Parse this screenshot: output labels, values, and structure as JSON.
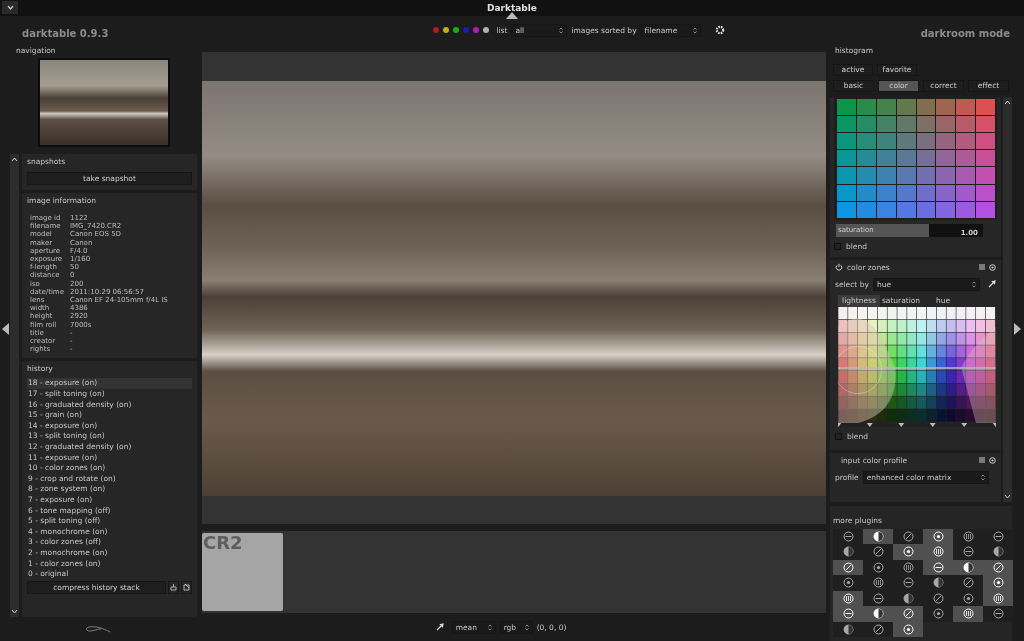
{
  "window": {
    "title": "Darktable"
  },
  "app": {
    "name": "darktable 0.9.3",
    "mode": "darkroom mode"
  },
  "filter_bar": {
    "color_labels": [
      {
        "color": "#b01c1c"
      },
      {
        "color": "#b8b01c"
      },
      {
        "color": "#1cae1c"
      },
      {
        "color": "#1c1cb0"
      },
      {
        "color": "#b01cb0"
      },
      {
        "color": "#b0b0b0"
      }
    ],
    "list_label": "list",
    "list_value": "all",
    "sort_label": "images sorted by",
    "sort_value": "filename"
  },
  "left": {
    "navigation": {
      "label": "navigation"
    },
    "snapshots": {
      "title": "snapshots",
      "button": "take snapshot"
    },
    "image_information": {
      "title": "image information",
      "fields": [
        {
          "label": "image id",
          "value": "1122"
        },
        {
          "label": "filename",
          "value": "IMG_7420.CR2"
        },
        {
          "label": "model",
          "value": "Canon EOS 5D"
        },
        {
          "label": "maker",
          "value": "Canon"
        },
        {
          "label": "aperture",
          "value": "F/4.0"
        },
        {
          "label": "exposure",
          "value": "1/160"
        },
        {
          "label": "f-length",
          "value": "50"
        },
        {
          "label": "distance",
          "value": "0"
        },
        {
          "label": "iso",
          "value": "200"
        },
        {
          "label": "date/time",
          "value": "2011:10:29 06:56:57"
        },
        {
          "label": "lens",
          "value": "Canon EF 24-105mm f/4L IS"
        },
        {
          "label": "width",
          "value": "4386"
        },
        {
          "label": "height",
          "value": "2920"
        },
        {
          "label": "film roll",
          "value": "7000s"
        },
        {
          "label": "title",
          "value": "-"
        },
        {
          "label": "creator",
          "value": "-"
        },
        {
          "label": "rights",
          "value": "-"
        }
      ]
    },
    "history": {
      "title": "history",
      "items": [
        {
          "label": "18 - exposure (on)",
          "selected": true
        },
        {
          "label": "17 - split toning (on)",
          "selected": false
        },
        {
          "label": "16 - graduated density (on)",
          "selected": false
        },
        {
          "label": "15 - grain (on)",
          "selected": false
        },
        {
          "label": "14 - exposure (on)",
          "selected": false
        },
        {
          "label": "13 - split toning (on)",
          "selected": false
        },
        {
          "label": "12 - graduated density (on)",
          "selected": false
        },
        {
          "label": "11 - exposure (on)",
          "selected": false
        },
        {
          "label": "10 - color zones (on)",
          "selected": false
        },
        {
          "label": "9 - crop and rotate (on)",
          "selected": false
        },
        {
          "label": "8 - zone system (on)",
          "selected": false
        },
        {
          "label": "7 - exposure (on)",
          "selected": false
        },
        {
          "label": "6 - tone mapping (off)",
          "selected": false
        },
        {
          "label": "5 - split toning (off)",
          "selected": false
        },
        {
          "label": "4 - monochrome (on)",
          "selected": false
        },
        {
          "label": "3 - color zones (off)",
          "selected": false
        },
        {
          "label": "2 - monochrome (on)",
          "selected": false
        },
        {
          "label": "1 - color zones (on)",
          "selected": false
        },
        {
          "label": "0 - original",
          "selected": false
        }
      ],
      "compress_button": "compress history stack"
    }
  },
  "filmstrip": {
    "thumbnail_label": "CR2"
  },
  "bottom_bar": {
    "mode": "mean",
    "colorspace": "rgb",
    "reading": "(0, 0, 0)"
  },
  "right": {
    "histogram": {
      "label": "histogram"
    },
    "preset_tabs": [
      {
        "label": "active",
        "selected": false
      },
      {
        "label": "favorite",
        "selected": false
      }
    ],
    "group_tabs": [
      {
        "label": "basic",
        "selected": false
      },
      {
        "label": "color",
        "selected": true
      },
      {
        "label": "correct",
        "selected": false
      },
      {
        "label": "effect",
        "selected": false
      }
    ],
    "color_correction": {
      "slider_label": "saturation",
      "slider_value": "1.00",
      "level": 0.63,
      "blend_label": "blend",
      "blend_checked": false
    },
    "color_zones": {
      "title": "color zones",
      "select_by_label": "select by",
      "select_by_value": "hue",
      "tabs": [
        {
          "label": "lightness",
          "selected": true
        },
        {
          "label": "saturation",
          "selected": false
        },
        {
          "label": "hue",
          "selected": false
        }
      ],
      "blend_label": "blend",
      "blend_checked": false
    },
    "input_color_profile": {
      "title": "input color profile",
      "profile_label": "profile",
      "profile_value": "enhanced color matrix"
    },
    "more_plugins": {
      "title": "more plugins",
      "plugins": [
        {
          "enabled": false
        },
        {
          "enabled": true
        },
        {
          "enabled": false
        },
        {
          "enabled": true
        },
        {
          "enabled": false
        },
        {
          "enabled": false
        },
        {
          "enabled": false
        },
        {
          "enabled": false
        },
        {
          "enabled": true
        },
        {
          "enabled": true
        },
        {
          "enabled": false
        },
        {
          "enabled": false
        },
        {
          "enabled": true
        },
        {
          "enabled": false
        },
        {
          "enabled": false
        },
        {
          "enabled": true
        },
        {
          "enabled": true
        },
        {
          "enabled": true
        },
        {
          "enabled": false
        },
        {
          "enabled": false
        },
        {
          "enabled": false
        },
        {
          "enabled": false
        },
        {
          "enabled": false
        },
        {
          "enabled": true
        },
        {
          "enabled": true
        },
        {
          "enabled": false
        },
        {
          "enabled": false
        },
        {
          "enabled": false
        },
        {
          "enabled": false
        },
        {
          "enabled": true
        },
        {
          "enabled": true
        },
        {
          "enabled": true
        },
        {
          "enabled": true
        },
        {
          "enabled": false
        },
        {
          "enabled": true
        },
        {
          "enabled": false
        },
        {
          "enabled": false
        },
        {
          "enabled": false
        },
        {
          "enabled": true
        }
      ]
    }
  }
}
